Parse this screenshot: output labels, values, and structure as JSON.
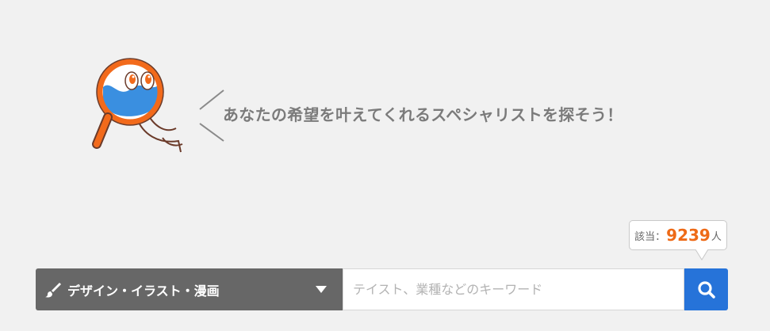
{
  "hero": {
    "headline": "あなたの希望を叶えてくれるスペシャリストを探そう！",
    "mascot_icon": "magnifier-mascot-icon"
  },
  "result_count": {
    "prefix": "該当：",
    "value": "9239",
    "suffix": "人"
  },
  "search": {
    "category_label": "デザイン・イラスト・漫画",
    "category_icon": "brush-icon",
    "keyword_placeholder": "テイスト、業種などのキーワード",
    "keyword_value": "",
    "submit_icon": "search-icon"
  },
  "colors": {
    "background": "#f1f1f1",
    "accent_orange": "#ee6a17",
    "search_blue": "#2673d9",
    "select_gray": "#676767",
    "headline_gray": "#7b7b7b"
  }
}
